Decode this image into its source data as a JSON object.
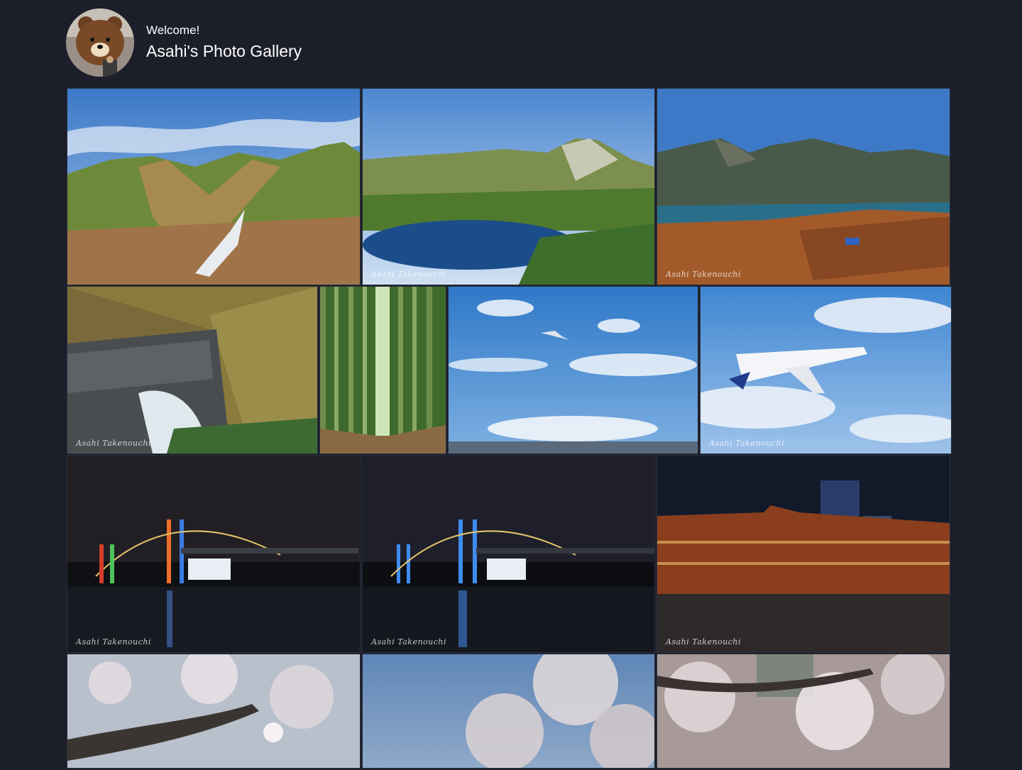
{
  "header": {
    "welcome": "Welcome!",
    "title": "Asahi's Photo Gallery",
    "avatar_icon": "bear-avatar-icon"
  },
  "gallery": {
    "photos": [
      {
        "subject": "mountain-valley-photo",
        "signature": ""
      },
      {
        "subject": "mountain-pond-photo",
        "signature": "Asahi Takenouchi"
      },
      {
        "subject": "mountain-dam-lake-photo",
        "signature": "Asahi Takenouchi"
      },
      {
        "subject": "dam-waterfall-photo",
        "signature": "Asahi Takenouchi"
      },
      {
        "subject": "bamboo-forest-photo",
        "signature": ""
      },
      {
        "subject": "airplane-sky-photo",
        "signature": ""
      },
      {
        "subject": "airplane-closeup-photo",
        "signature": "Asahi Takenouchi"
      },
      {
        "subject": "rainbow-bridge-color-photo",
        "signature": "Asahi Takenouchi"
      },
      {
        "subject": "rainbow-bridge-blue-photo",
        "signature": "Asahi Takenouchi"
      },
      {
        "subject": "tokyo-station-night-photo",
        "signature": "Asahi Takenouchi"
      },
      {
        "subject": "cherry-blossom-photo-1",
        "signature": ""
      },
      {
        "subject": "cherry-blossom-photo-2",
        "signature": ""
      },
      {
        "subject": "cherry-blossom-photo-3",
        "signature": ""
      }
    ]
  },
  "colors": {
    "background": "#1c1f2a",
    "text": "#ffffff"
  }
}
